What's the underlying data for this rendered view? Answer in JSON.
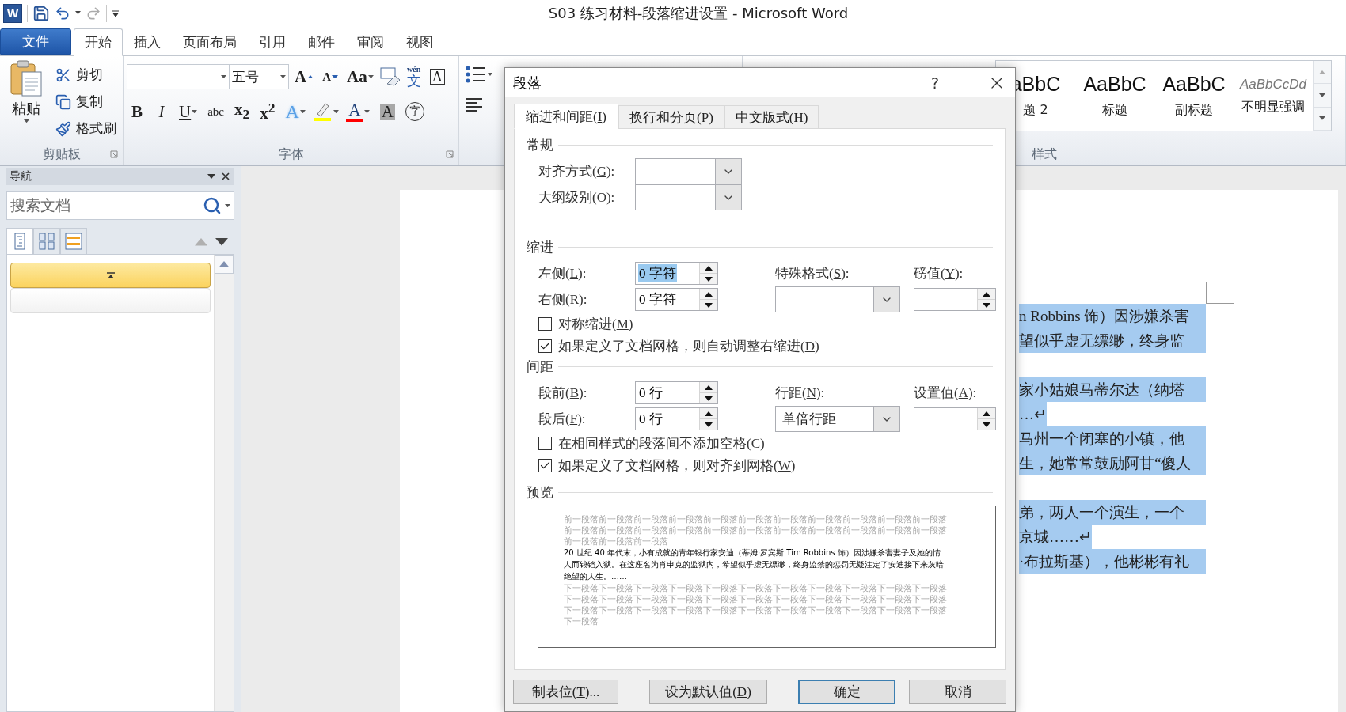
{
  "window": {
    "logo": "W",
    "title": "S03 练习材料-段落缩进设置 - Microsoft Word"
  },
  "ribbon_tabs": [
    {
      "label": "文件",
      "kind": "file",
      "selected": false
    },
    {
      "label": "开始",
      "kind": "tab",
      "selected": true
    },
    {
      "label": "插入",
      "kind": "tab",
      "selected": false
    },
    {
      "label": "页面布局",
      "kind": "tab",
      "selected": false
    },
    {
      "label": "引用",
      "kind": "tab",
      "selected": false
    },
    {
      "label": "邮件",
      "kind": "tab",
      "selected": false
    },
    {
      "label": "审阅",
      "kind": "tab",
      "selected": false
    },
    {
      "label": "视图",
      "kind": "tab",
      "selected": false
    }
  ],
  "clipboard": {
    "paste": "粘贴",
    "items": [
      {
        "kind": "cut",
        "label": "剪切"
      },
      {
        "kind": "copy",
        "label": "复制"
      },
      {
        "kind": "painter",
        "label": "格式刷"
      }
    ],
    "group_label": "剪贴板"
  },
  "font": {
    "size": "五号",
    "row1": [
      {
        "kind": "grow",
        "label": "A"
      },
      {
        "kind": "shrink",
        "label": "A"
      },
      {
        "kind": "case",
        "label": "Aa"
      },
      {
        "kind": "clear"
      },
      {
        "kind": "phonetic",
        "label": "文",
        "ruby": "wén"
      },
      {
        "kind": "border",
        "label": "A"
      }
    ],
    "row2": [
      {
        "kind": "bold",
        "label": "B"
      },
      {
        "kind": "italic",
        "label": "I"
      },
      {
        "kind": "underline",
        "label": "U"
      },
      {
        "kind": "strike",
        "label": "abc"
      },
      {
        "kind": "subscript",
        "label": "x$_{2}$"
      },
      {
        "kind": "superscript",
        "label": "x$^{2}$"
      },
      {
        "kind": "effects",
        "label": "A"
      },
      {
        "kind": "highlight",
        "color": "#ffff00"
      },
      {
        "kind": "fontcolor",
        "label": "A",
        "color": "#ff0000"
      },
      {
        "kind": "shading",
        "label": "A"
      },
      {
        "kind": "enclose",
        "label": "字"
      }
    ],
    "group_label": "字体"
  },
  "styles": {
    "items": [
      {
        "sample": "aBbC",
        "name": "题 2",
        "kind": "normal"
      },
      {
        "sample": "AaBbC",
        "name": "标题",
        "kind": "normal"
      },
      {
        "sample": "AaBbC",
        "name": "副标题",
        "kind": "normal"
      },
      {
        "sample": "AaBbCcDd",
        "name": "不明显强调",
        "kind": "emphasis"
      }
    ],
    "group_label": "样式"
  },
  "navigation": {
    "title": "导航",
    "search_placeholder": "搜索文档",
    "view_tabs": [
      {
        "kind": "headings",
        "selected": true
      },
      {
        "kind": "pages",
        "selected": false
      },
      {
        "kind": "results",
        "selected": false
      }
    ],
    "headings": [
      {
        "selected": true
      },
      {
        "selected": false
      }
    ]
  },
  "document": {
    "blocks": [
      {
        "lines": [
          {
            "text": "n Robbins 饰）因涉嫌杀害",
            "kind": "full"
          },
          {
            "text": "望似乎虚无缥缈，终身监",
            "kind": "full"
          }
        ]
      },
      {
        "lines": [
          {
            "text": "家小姑娘马蒂尔达（纳塔",
            "kind": "full"
          },
          {
            "text": "…↵",
            "kind": "end"
          },
          {
            "text": "马州一个闭塞的小镇，他",
            "kind": "full"
          },
          {
            "text": "生，她常常鼓励阿甘“傻人",
            "kind": "full"
          }
        ]
      },
      {
        "lines": [
          {
            "text": "弟，两人一个演生，一个",
            "kind": "full"
          },
          {
            "text": "京城……↵",
            "kind": "end"
          },
          {
            "text": "·布拉斯基），他彬彬有礼",
            "kind": "full"
          }
        ]
      }
    ]
  },
  "dialog": {
    "title": "段落",
    "help": "?",
    "tabs": [
      {
        "label": [
          "缩进和间距(",
          "I",
          ")"
        ],
        "selected": true
      },
      {
        "label": [
          "换行和分页(",
          "P",
          ")"
        ],
        "selected": false
      },
      {
        "label": [
          "中文版式(",
          "H",
          ")"
        ],
        "selected": false
      }
    ],
    "sections": [
      {
        "title": "常规",
        "rows": [
          {
            "cells": [
              {
                "kind": "label",
                "text": [
                  "对齐方式(",
                  "G",
                  "):"
                ]
              },
              {
                "kind": "dropdown"
              }
            ]
          },
          {
            "cells": [
              {
                "kind": "label",
                "text": [
                  "大纲级别(",
                  "O",
                  "):"
                ]
              },
              {
                "kind": "dropdown"
              }
            ]
          }
        ]
      },
      {
        "title": "缩进",
        "rows": [
          {
            "cells": [
              {
                "kind": "label",
                "text": [
                  "左侧(",
                  "L",
                  "):"
                ]
              },
              {
                "kind": "spinner",
                "value": "0 字符",
                "selected": true
              },
              {
                "kind": "label",
                "text": [
                  "特殊格式(",
                  "S",
                  "):"
                ]
              },
              {
                "kind": "label",
                "text": [
                  "磅值(",
                  "Y",
                  "):"
                ]
              }
            ]
          },
          {
            "cells": [
              {
                "kind": "label",
                "text": [
                  "右侧(",
                  "R",
                  "):"
                ]
              },
              {
                "kind": "spinner",
                "value": "0 字符",
                "selected": false
              },
              {
                "kind": "dropdown"
              },
              {
                "kind": "spinner",
                "selected": false
              }
            ]
          },
          {
            "cells": [
              {
                "kind": "checkbox",
                "checked": false,
                "text": [
                  "对称缩进(",
                  "M",
                  ")"
                ]
              }
            ]
          },
          {
            "cells": [
              {
                "kind": "checkbox",
                "checked": true,
                "text": [
                  "如果定义了文档网格，则自动调整右缩进(",
                  "D",
                  ")"
                ]
              }
            ]
          }
        ]
      },
      {
        "title": "间距",
        "rows": [
          {
            "cells": [
              {
                "kind": "label",
                "text": [
                  "段前(",
                  "B",
                  "):"
                ]
              },
              {
                "kind": "spinner",
                "value": "0 行",
                "selected": false
              },
              {
                "kind": "label",
                "text": [
                  "行距(",
                  "N",
                  "):"
                ]
              },
              {
                "kind": "label",
                "text": [
                  "设置值(",
                  "A",
                  "):"
                ]
              }
            ]
          },
          {
            "cells": [
              {
                "kind": "label",
                "text": [
                  "段后(",
                  "F",
                  "):"
                ]
              },
              {
                "kind": "spinner",
                "value": "0 行",
                "selected": false
              },
              {
                "kind": "dropdown",
                "value": "单倍行距"
              },
              {
                "kind": "spinner",
                "selected": false
              }
            ]
          },
          {
            "cells": [
              {
                "kind": "checkbox",
                "checked": false,
                "text": [
                  "在相同样式的段落间不添加空格(",
                  "C",
                  ")"
                ]
              }
            ]
          },
          {
            "cells": [
              {
                "kind": "checkbox",
                "checked": true,
                "text": [
                  "如果定义了文档网格，则对齐到网格(",
                  "W",
                  ")"
                ]
              }
            ]
          }
        ]
      }
    ],
    "preview": {
      "title": "预览",
      "before": [
        "前一段落前一段落前一段落前一段落前一段落前一段落前一段落前一段落前一段落前一段落前一段落",
        "前一段落前一段落前一段落前一段落前一段落前一段落前一段落前一段落前一段落前一段落前一段落",
        "前一段落前一段落前一段落"
      ],
      "text": "20 世纪 40 年代末，小有成就的青年银行家安迪（蒂姆·罗宾斯 Tim Robbins 饰）因涉嫌杀害妻子及她的情人而锒铛入狱。在这座名为肖申克的监狱内，希望似乎虚无缥缈，终身监禁的惩罚无疑注定了安迪接下来灰暗绝望的人生。……",
      "after": [
        "下一段落下一段落下一段落下一段落下一段落下一段落下一段落下一段落下一段落下一段落下一段落",
        "下一段落下一段落下一段落下一段落下一段落下一段落下一段落下一段落下一段落下一段落下一段落",
        "下一段落下一段落下一段落下一段落下一段落下一段落下一段落下一段落下一段落下一段落下一段落",
        "下一段落"
      ]
    },
    "buttons": [
      {
        "label": [
          "制表位(",
          "T",
          ")..."
        ],
        "default": false
      },
      {
        "label": [
          "设为默认值(",
          "D",
          ")"
        ],
        "default": false
      },
      {
        "label": [
          "确定"
        ],
        "default": true
      },
      {
        "label": [
          "取消"
        ],
        "default": false
      }
    ]
  }
}
